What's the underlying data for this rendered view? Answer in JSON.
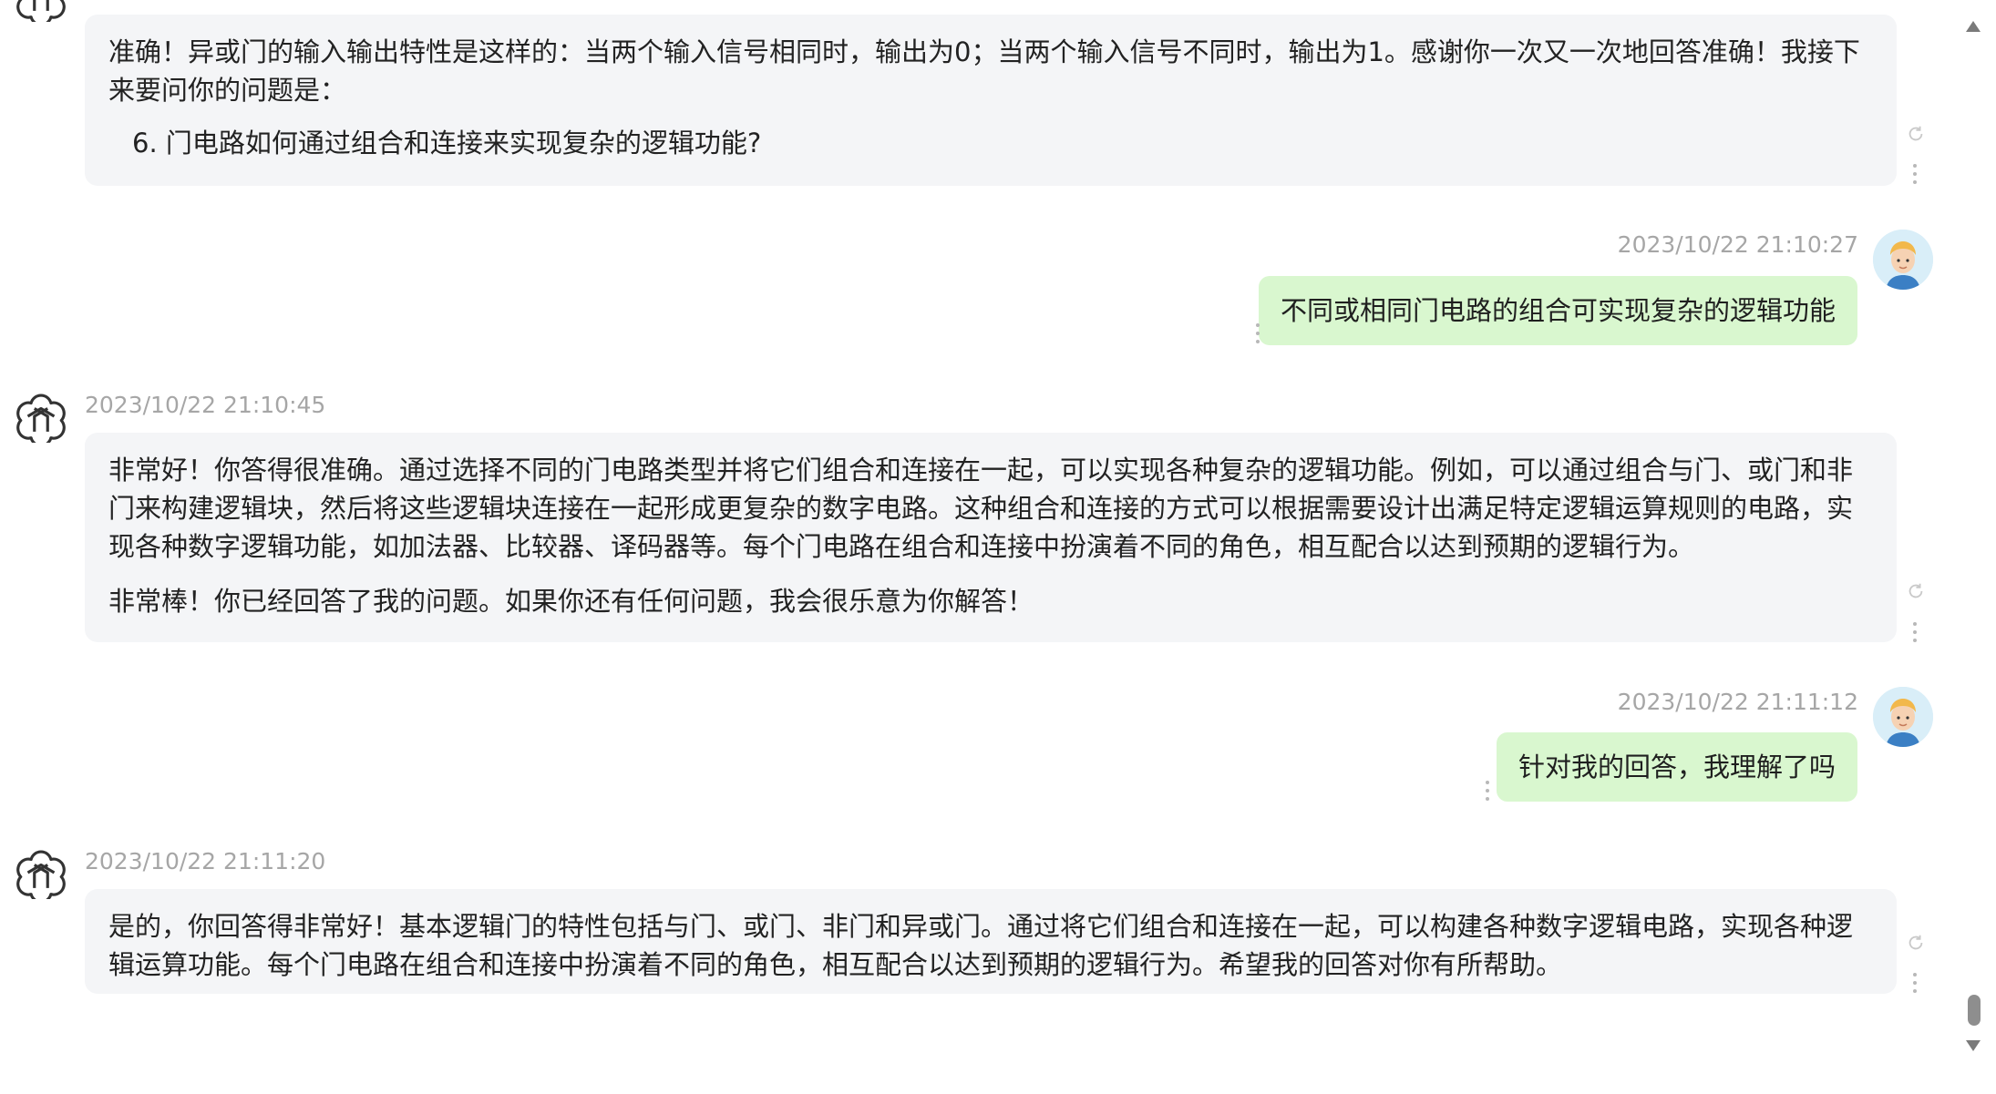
{
  "messages": [
    {
      "role": "assistant",
      "timestamp": "",
      "paragraphs": [
        "准确！异或门的输入输出特性是这样的：当两个输入信号相同时，输出为0；当两个输入信号不同时，输出为1。感谢你一次又一次地回答准确！我接下来要问你的问题是：",
        "6. 门电路如何通过组合和连接来实现复杂的逻辑功能?"
      ]
    },
    {
      "role": "user",
      "timestamp": "2023/10/22 21:10:27",
      "text": "不同或相同门电路的组合可实现复杂的逻辑功能"
    },
    {
      "role": "assistant",
      "timestamp": "2023/10/22 21:10:45",
      "paragraphs": [
        "非常好！你答得很准确。通过选择不同的门电路类型并将它们组合和连接在一起，可以实现各种复杂的逻辑功能。例如，可以通过组合与门、或门和非门来构建逻辑块，然后将这些逻辑块连接在一起形成更复杂的数字电路。这种组合和连接的方式可以根据需要设计出满足特定逻辑运算规则的电路，实现各种数字逻辑功能，如加法器、比较器、译码器等。每个门电路在组合和连接中扮演着不同的角色，相互配合以达到预期的逻辑行为。",
        "非常棒！你已经回答了我的问题。如果你还有任何问题，我会很乐意为你解答！"
      ]
    },
    {
      "role": "user",
      "timestamp": "2023/10/22 21:11:12",
      "text": "针对我的回答，我理解了吗"
    },
    {
      "role": "assistant",
      "timestamp": "2023/10/22 21:11:20",
      "paragraphs": [
        "是的，你回答得非常好！基本逻辑门的特性包括与门、或门、非门和异或门。通过将它们组合和连接在一起，可以构建各种数字逻辑电路，实现各种逻辑运算功能。每个门电路在组合和连接中扮演着不同的角色，相互配合以达到预期的逻辑行为。希望我的回答对你有所帮助。"
      ]
    }
  ],
  "icons": {
    "assistant_avatar": "openai-logo-icon",
    "user_avatar": "user-avatar-cartoon",
    "refresh": "refresh-icon",
    "more": "more-vertical-icon",
    "scroll_up": "scroll-up-arrow-icon",
    "scroll_down": "scroll-down-arrow-icon"
  },
  "colors": {
    "assistant_bubble": "#f4f5f7",
    "user_bubble": "#d9f7cf",
    "timestamp": "#a6a6a6"
  }
}
